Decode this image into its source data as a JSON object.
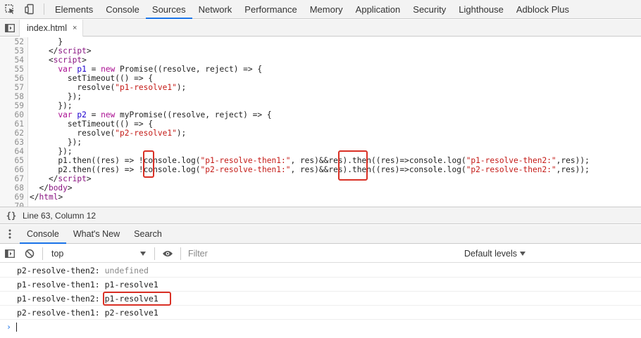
{
  "topbar": {
    "tabs": [
      "Elements",
      "Console",
      "Sources",
      "Network",
      "Performance",
      "Memory",
      "Application",
      "Security",
      "Lighthouse",
      "Adblock Plus"
    ],
    "active": "Sources"
  },
  "filebar": {
    "file_name": "index.html",
    "close_glyph": "×"
  },
  "editor": {
    "lines": [
      {
        "n": "52",
        "html": "      }"
      },
      {
        "n": "53",
        "html": "    &lt;/<span class='tag'>script</span>&gt;"
      },
      {
        "n": "54",
        "html": "    &lt;<span class='tag'>script</span>&gt;"
      },
      {
        "n": "55",
        "html": "      <span class='kw'>var</span> <span class='var'>p1</span> = <span class='kw'>new</span> Promise((resolve, reject) =&gt; {"
      },
      {
        "n": "56",
        "html": "        setTimeout(() =&gt; {"
      },
      {
        "n": "57",
        "html": "          resolve(<span class='str'>\"p1-resolve1\"</span>);"
      },
      {
        "n": "58",
        "html": "        });"
      },
      {
        "n": "59",
        "html": "      });"
      },
      {
        "n": "60",
        "html": "      <span class='kw'>var</span> <span class='var'>p2</span> = <span class='kw'>new</span> myPromise((resolve, reject) =&gt; {"
      },
      {
        "n": "61",
        "html": "        setTimeout(() =&gt; {"
      },
      {
        "n": "62",
        "html": "          resolve(<span class='str'>\"p2-resolve1\"</span>);"
      },
      {
        "n": "63",
        "html": "        });"
      },
      {
        "n": "64",
        "html": "      });"
      },
      {
        "n": "65",
        "html": "      p1.then((res) =&gt; !console.log(<span class='str'>\"p1-resolve-then1:\"</span>, res)&amp;&amp;res).then((res)=&gt;console.log(<span class='str'>\"p1-resolve-then2:\"</span>,res));"
      },
      {
        "n": "66",
        "html": "      p2.then((res) =&gt; !console.log(<span class='str'>\"p2-resolve-then1:\"</span>, res)&amp;&amp;res).then((res)=&gt;console.log(<span class='str'>\"p2-resolve-then2:\"</span>,res));"
      },
      {
        "n": "67",
        "html": "    &lt;/<span class='tag'>script</span>&gt;"
      },
      {
        "n": "68",
        "html": "  &lt;/<span class='tag'>body</span>&gt;"
      },
      {
        "n": "69",
        "html": "&lt;/<span class='tag'>html</span>&gt;"
      },
      {
        "n": "70",
        "html": ""
      }
    ]
  },
  "status": {
    "braces": "{}",
    "position": "Line 63, Column 12"
  },
  "drawer": {
    "tabs": [
      "Console",
      "What's New",
      "Search"
    ],
    "active": "Console"
  },
  "console_toolbar": {
    "context": "top",
    "filter_placeholder": "Filter",
    "levels": "Default levels"
  },
  "console_output": [
    {
      "label": "p2-resolve-then2: ",
      "value": "undefined",
      "undefined": true
    },
    {
      "label": "p1-resolve-then1: ",
      "value": "p1-resolve1",
      "undefined": false
    },
    {
      "label": "p1-resolve-then2: ",
      "value": "p1-resolve1",
      "undefined": false
    },
    {
      "label": "p2-resolve-then1: ",
      "value": "p2-resolve1",
      "undefined": false
    }
  ],
  "prompt_glyph": "›"
}
